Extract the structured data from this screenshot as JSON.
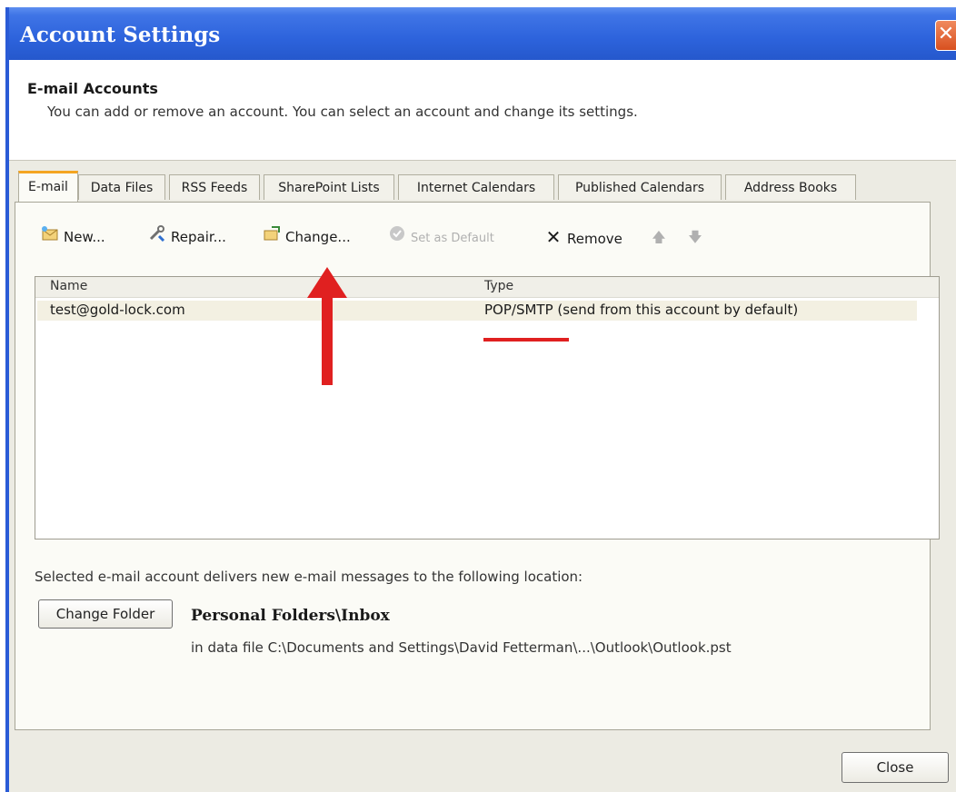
{
  "window": {
    "title": "Account Settings"
  },
  "header": {
    "title": "E-mail Accounts",
    "description": "You can add or remove an account. You can select an account and change its settings."
  },
  "tabs": [
    {
      "label": "E-mail",
      "active": true
    },
    {
      "label": "Data Files"
    },
    {
      "label": "RSS Feeds"
    },
    {
      "label": "SharePoint Lists"
    },
    {
      "label": "Internet Calendars"
    },
    {
      "label": "Published Calendars"
    },
    {
      "label": "Address Books"
    }
  ],
  "toolbar": {
    "new_label": "New...",
    "repair_label": "Repair...",
    "change_label": "Change...",
    "set_default_label": "Set as Default",
    "remove_label": "Remove"
  },
  "table": {
    "columns": [
      "Name",
      "Type"
    ],
    "rows": [
      {
        "name": "test@gold-lock.com",
        "type": "POP/SMTP (send from this account by default)"
      }
    ]
  },
  "footer": {
    "delivery_text": "Selected e-mail account delivers new e-mail messages to the following location:",
    "change_folder_label": "Change Folder",
    "folder_name": "Personal Folders\\Inbox",
    "folder_path": "in data file C:\\Documents and Settings\\David Fetterman\\...\\Outlook\\Outlook.pst",
    "close_label": "Close"
  },
  "colors": {
    "titlebar": "#2d63dc",
    "annotation": "#e02020",
    "active_tab_accent": "#f4a521"
  },
  "icons": {
    "new": "new-mail-icon",
    "repair": "repair-icon",
    "change": "change-icon",
    "set_default": "check-circle-icon",
    "remove": "remove-x-icon",
    "move_up": "arrow-up-icon",
    "move_down": "arrow-down-icon"
  }
}
